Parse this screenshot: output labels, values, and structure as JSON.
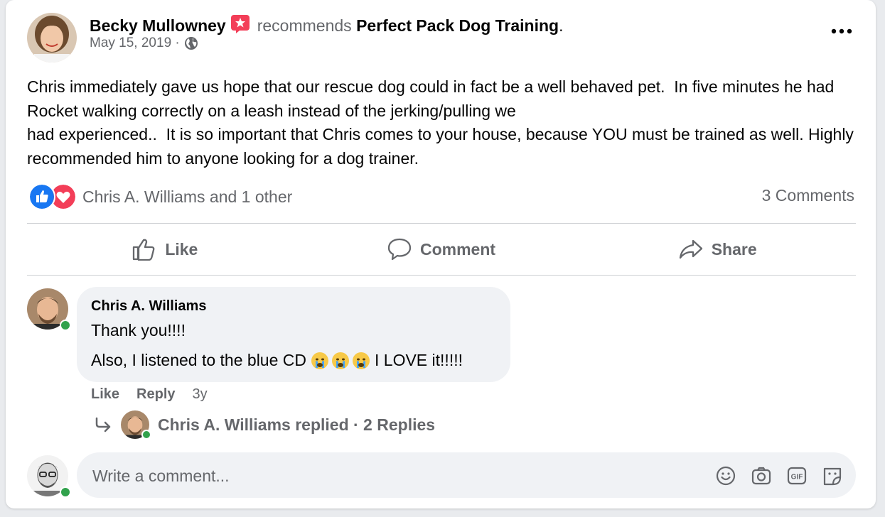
{
  "post": {
    "author": "Becky Mullowney",
    "recommends_text": "recommends",
    "page_name": "Perfect Pack Dog Training",
    "page_suffix": ".",
    "date": "May 15, 2019 ·",
    "body": "Chris immediately gave us hope that our rescue dog could in fact be a well behaved pet.  In five minutes he had Rocket walking correctly on a leash instead of the jerking/pulling we\nhad experienced..  It is so important that Chris comes to your house, because YOU must be trained as well. Highly recommended him to anyone looking for a dog trainer."
  },
  "reactions": {
    "names": "Chris A. Williams and 1 other",
    "comments_count": "3 Comments"
  },
  "actions": {
    "like": "Like",
    "comment": "Comment",
    "share": "Share"
  },
  "comment": {
    "author": "Chris A. Williams",
    "line1": "Thank you!!!!",
    "line2_before": "Also, I listened to the blue CD",
    "line2_after": "I LOVE it!!!!!",
    "like": "Like",
    "reply": "Reply",
    "time": "3y",
    "replies_text": "Chris A. Williams replied · 2 Replies"
  },
  "composer": {
    "placeholder": "Write a comment..."
  },
  "colors": {
    "accent": "#1877f2",
    "love": "#f33e58",
    "online": "#31a24c",
    "muted_text": "#65676b"
  },
  "icons": [
    "more-options-icon",
    "globe-icon",
    "like-reaction-icon",
    "love-reaction-icon",
    "thumbs-up-icon",
    "comment-icon",
    "share-icon",
    "reply-arrow-icon",
    "emoji-icon",
    "camera-icon",
    "gif-icon",
    "sticker-icon",
    "recommend-badge-icon",
    "crying-emoji-icon"
  ]
}
